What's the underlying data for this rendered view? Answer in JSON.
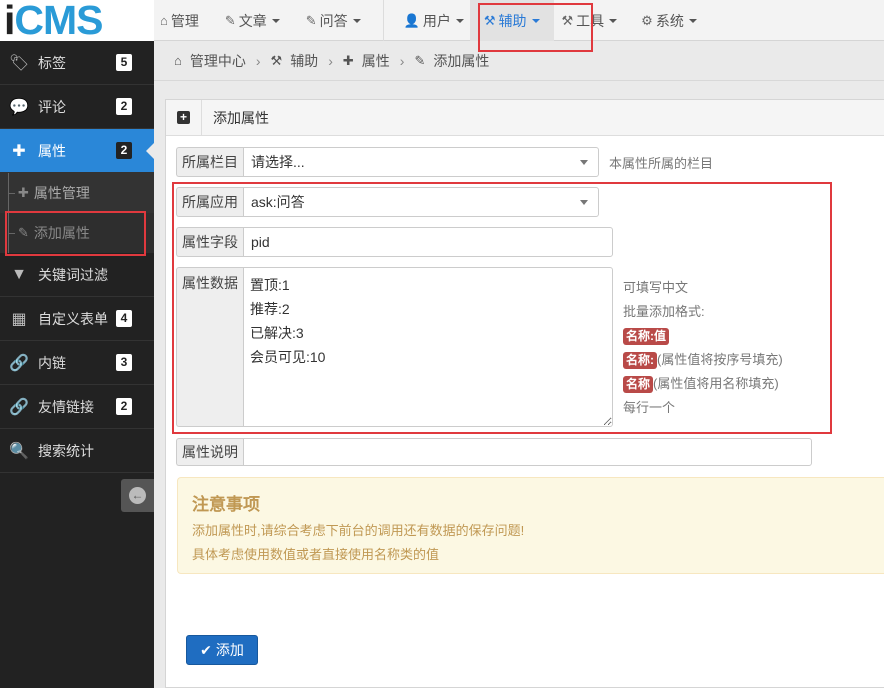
{
  "logo": {
    "first": "i",
    "rest": "CMS"
  },
  "nav": [
    {
      "icon": "⌂",
      "icon_name": "home-icon",
      "label": "管理",
      "caret": false
    },
    {
      "icon": "✎",
      "icon_name": "edit-icon",
      "label": "文章",
      "caret": true
    },
    {
      "icon": "✎",
      "icon_name": "edit-icon",
      "label": "问答",
      "caret": true
    },
    {
      "icon": "👤",
      "icon_name": "user-icon",
      "label": "用户",
      "caret": true
    },
    {
      "icon": "⚒",
      "icon_name": "gavel-icon",
      "label": "辅助",
      "caret": true
    },
    {
      "icon": "⚒",
      "icon_name": "gavel-icon",
      "label": "工具",
      "caret": true
    },
    {
      "icon": "⚙",
      "icon_name": "gear-icon",
      "label": "系统",
      "caret": true
    }
  ],
  "sidebar": {
    "items": [
      {
        "icon": "🏷",
        "icon_name": "tags-icon",
        "label": "标签",
        "badge": "5"
      },
      {
        "icon": "💬",
        "icon_name": "comments-icon",
        "label": "评论",
        "badge": "2"
      },
      {
        "icon": "✚",
        "icon_name": "puzzle-icon",
        "label": "属性",
        "badge": "2"
      }
    ],
    "sub_items": [
      {
        "label": "属性管理",
        "icon": "✚",
        "icon_name": "puzzle-icon"
      },
      {
        "label": "添加属性",
        "icon": "✎",
        "icon_name": "edit-icon"
      }
    ],
    "more_items": [
      {
        "icon": "▼",
        "icon_name": "filter-icon",
        "label": "关键词过滤",
        "badge": ""
      },
      {
        "icon": "▦",
        "icon_name": "building-icon",
        "label": "自定义表单",
        "badge": "4"
      },
      {
        "icon": "🔗",
        "icon_name": "paperclip-icon",
        "label": "内链",
        "badge": "3"
      },
      {
        "icon": "🔗",
        "icon_name": "link-icon",
        "label": "友情链接",
        "badge": "2"
      },
      {
        "icon": "🔍",
        "icon_name": "search-icon",
        "label": "搜索统计",
        "badge": ""
      }
    ]
  },
  "breadcrumb": [
    "管理中心",
    "辅助",
    "属性",
    "添加属性"
  ],
  "panel": {
    "title": "添加属性"
  },
  "form": {
    "category": {
      "label": "所属栏目",
      "value": "请选择...",
      "help": "本属性所属的栏目"
    },
    "app": {
      "label": "所属应用",
      "value": "ask:问答"
    },
    "field": {
      "label": "属性字段",
      "value": "pid"
    },
    "data": {
      "label": "属性数据",
      "value": "置顶:1\n推荐:2\n已解决:3\n会员可见:10"
    },
    "desc": {
      "label": "属性说明",
      "value": ""
    }
  },
  "hints": {
    "line1": "可填写中文",
    "line2": "批量添加格式:",
    "tag1": "名称:值",
    "tag2": "名称:",
    "tag2_text": "(属性值将按序号填充)",
    "tag3": "名称",
    "tag3_text": "(属性值将用名称填充)",
    "line6": "每行一个"
  },
  "notice": {
    "title": "注意事项",
    "line1": "添加属性时,请综合考虑下前台的调用还有数据的保存问题!",
    "line2": "具体考虑使用数值或者直接使用名称类的值"
  },
  "submit": {
    "icon": "✔",
    "label": "添加"
  }
}
